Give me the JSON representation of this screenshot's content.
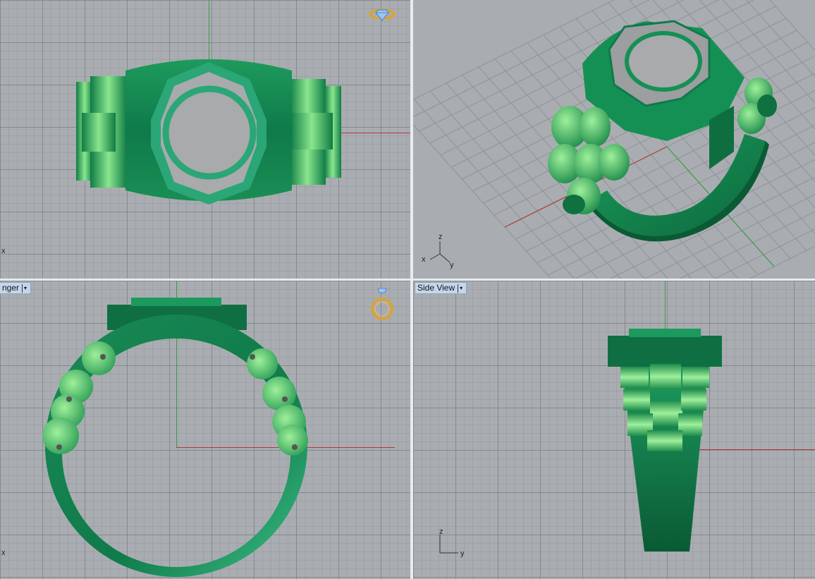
{
  "viewports": {
    "top_right": {
      "axes": {
        "z": "z",
        "x": "x",
        "y": "y"
      }
    },
    "top_left": {
      "axes": {
        "x": "x"
      }
    },
    "bottom_left": {
      "title": "nger",
      "axes": {
        "x": "x"
      }
    },
    "bottom_right": {
      "title": "Side View",
      "axes": {
        "z": "z",
        "y": "y"
      }
    }
  },
  "colors": {
    "viewport_bg": "#a9adb1",
    "ring_dark_green": "#0f7a4a",
    "ring_mid_green": "#2aa564",
    "ring_light_green": "#7fe08a",
    "bezel_grey": "#a8aaac",
    "axis_red": "#b03a3a",
    "axis_green": "#3f9a46",
    "icon_gold": "#e5a21a",
    "icon_blue": "#4e8bd0"
  },
  "icons": [
    "ring-gem-icon",
    "ring-side-icon",
    "dropdown-arrow-icon"
  ]
}
